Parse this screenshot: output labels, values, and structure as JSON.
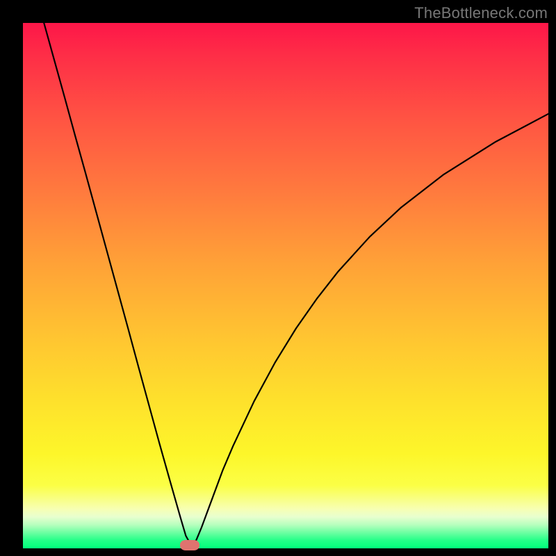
{
  "watermark": "TheBottleneck.com",
  "colors": {
    "frame": "#000000",
    "gradient_top": "#fd1648",
    "gradient_bottom": "#00ff7b",
    "curve": "#000000",
    "marker": "#e0736f"
  },
  "chart_data": {
    "type": "line",
    "title": "",
    "xlabel": "",
    "ylabel": "",
    "xlim": [
      0,
      100
    ],
    "ylim": [
      0,
      100
    ],
    "grid": false,
    "legend": null,
    "series": [
      {
        "name": "bottleneck-curve",
        "x": [
          4,
          6,
          8,
          10,
          12,
          14,
          16,
          18,
          20,
          22,
          24,
          26,
          28,
          30,
          31,
          32,
          33,
          34,
          36,
          38,
          40,
          44,
          48,
          52,
          56,
          60,
          66,
          72,
          80,
          90,
          100
        ],
        "values": [
          100,
          92.8,
          85.6,
          78.3,
          71.1,
          63.8,
          56.5,
          49.2,
          41.9,
          34.5,
          27.2,
          19.9,
          12.8,
          5.8,
          2.4,
          0.6,
          1.6,
          4.0,
          9.4,
          14.8,
          19.5,
          28.0,
          35.4,
          41.9,
          47.6,
          52.7,
          59.3,
          64.9,
          71.1,
          77.4,
          82.7
        ]
      }
    ],
    "annotations": [
      {
        "name": "min-marker",
        "x": 31.7,
        "y": 0.7
      }
    ]
  }
}
